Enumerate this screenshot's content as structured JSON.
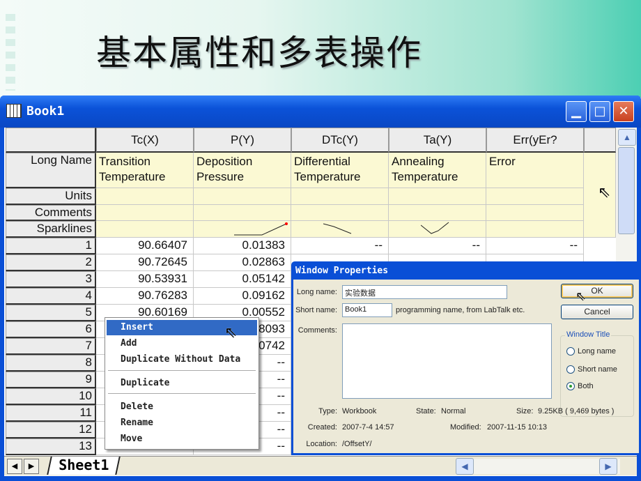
{
  "slide": {
    "title": "基本属性和多表操作"
  },
  "window": {
    "title": "Book1",
    "minimize": "▁",
    "maximize": "□",
    "close": "✕"
  },
  "columns": [
    {
      "header": "Tc(X)",
      "long_name": "Transition\nTemperature"
    },
    {
      "header": "P(Y)",
      "long_name": "Deposition\nPressure"
    },
    {
      "header": "DTc(Y)",
      "long_name": "Differential\nTemperature"
    },
    {
      "header": "Ta(Y)",
      "long_name": "Annealing\nTemperature"
    },
    {
      "header": "Err(yEr?",
      "long_name": "Error"
    }
  ],
  "row_labels": {
    "long_name": "Long Name",
    "units": "Units",
    "comments": "Comments",
    "sparklines": "Sparklines"
  },
  "rows": [
    {
      "n": "1",
      "c": [
        "90.66407",
        "0.01383",
        "--",
        "--",
        "--"
      ]
    },
    {
      "n": "2",
      "c": [
        "90.72645",
        "0.02863",
        "",
        "",
        ""
      ]
    },
    {
      "n": "3",
      "c": [
        "90.53931",
        "0.05142",
        "",
        "",
        ""
      ]
    },
    {
      "n": "4",
      "c": [
        "90.76283",
        "0.09162",
        "",
        "",
        ""
      ]
    },
    {
      "n": "5",
      "c": [
        "90.60169",
        "0.00552",
        "",
        "",
        ""
      ]
    },
    {
      "n": "6",
      "c": [
        "",
        "8093",
        "",
        "",
        ""
      ]
    },
    {
      "n": "7",
      "c": [
        "",
        "0742",
        "",
        "",
        ""
      ]
    },
    {
      "n": "8",
      "c": [
        "",
        "--",
        "",
        "",
        ""
      ]
    },
    {
      "n": "9",
      "c": [
        "",
        "--",
        "",
        "",
        ""
      ]
    },
    {
      "n": "10",
      "c": [
        "",
        "--",
        "",
        "",
        ""
      ]
    },
    {
      "n": "11",
      "c": [
        "",
        "--",
        "",
        "",
        ""
      ]
    },
    {
      "n": "12",
      "c": [
        "",
        "--",
        "",
        "",
        ""
      ]
    },
    {
      "n": "13",
      "c": [
        "",
        "--",
        "",
        "",
        ""
      ]
    }
  ],
  "tabs": {
    "sheet": "Sheet1"
  },
  "context_menu": {
    "items": [
      "Insert",
      "Add",
      "Duplicate Without Data",
      "Duplicate",
      "Delete",
      "Rename",
      "Move"
    ]
  },
  "dialog": {
    "title": "Window Properties",
    "long_name_label": "Long name:",
    "long_name_value": "实验数据",
    "short_name_label": "Short name:",
    "short_name_value": "Book1",
    "short_name_hint": "programming name, from LabTalk etc.",
    "comments_label": "Comments:",
    "ok": "OK",
    "cancel": "Cancel",
    "group_title": "Window Title",
    "radios": [
      "Long name",
      "Short name",
      "Both"
    ],
    "selected": "Both",
    "type_label": "Type:",
    "type": "Workbook",
    "state_label": "State:",
    "state": "Normal",
    "size_label": "Size:",
    "size": "9.25KB ( 9,469 bytes )",
    "created_label": "Created:",
    "created": "2007-7-4 14:57",
    "modified_label": "Modified:",
    "modified": "2007-11-15 10:13",
    "location_label": "Location:",
    "location": "/OffsetY/"
  },
  "colors": {
    "titlebar": "#0a4fd6",
    "label_rows": "#fbf9d3",
    "menu_highlight": "#316ac5"
  }
}
